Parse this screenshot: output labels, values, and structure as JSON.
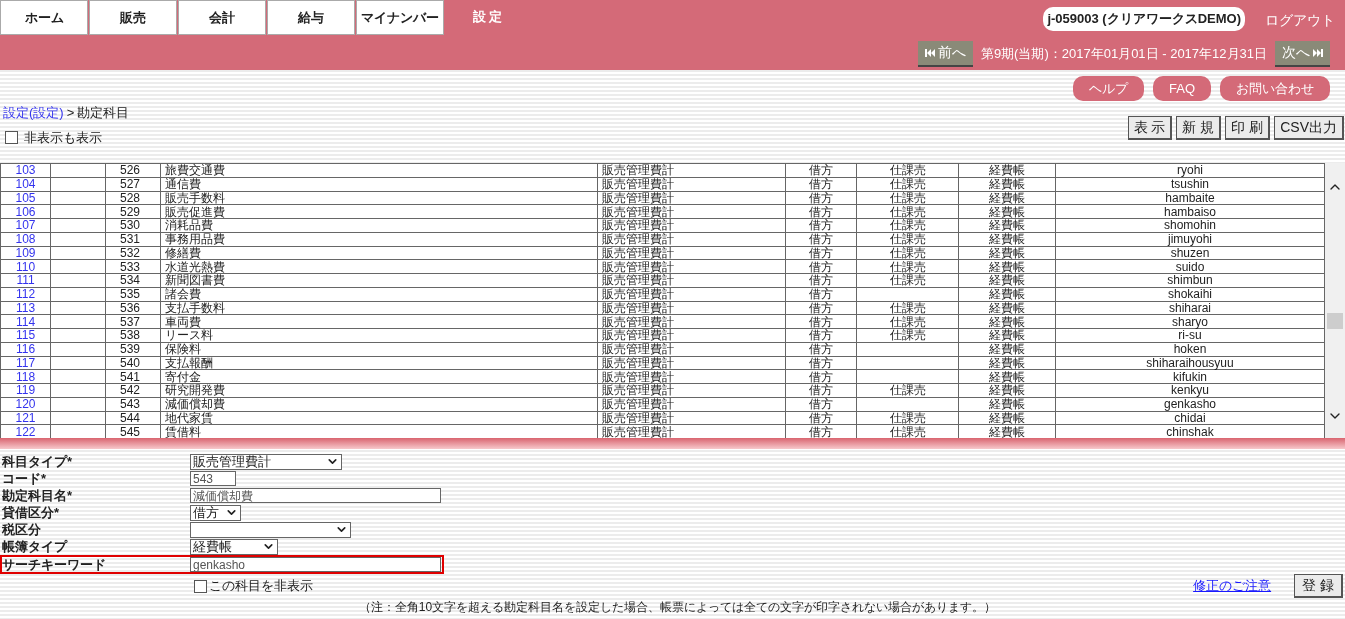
{
  "tabs": [
    {
      "label": "ホーム",
      "selected": false
    },
    {
      "label": "販売",
      "selected": false
    },
    {
      "label": "会計",
      "selected": false
    },
    {
      "label": "給与",
      "selected": false
    },
    {
      "label": "マイナンバー",
      "selected": false
    },
    {
      "label": "設定",
      "selected": true
    }
  ],
  "user": "j-059003 (クリアワークスDEMO)",
  "logout": "ログアウト",
  "period": {
    "prev": "前へ",
    "label": "第9期(当期)：2017年01月01日 - 2017年12月31日",
    "next": "次へ"
  },
  "help_buttons": [
    "ヘルプ",
    "FAQ",
    "お問い合わせ"
  ],
  "breadcrumb": {
    "link": "設定(設定)",
    "separator": ">",
    "current": "勘定科目"
  },
  "show_hidden": {
    "label": "非表示も表示",
    "checked": false
  },
  "toolbar": [
    "表 示",
    "新 規",
    "印 刷",
    "CSV出力"
  ],
  "table": {
    "rows": [
      {
        "no": "103",
        "code": "526",
        "name": "旅費交通費",
        "type": "販売管理費計",
        "side": "借方",
        "tax": "仕課売",
        "ledger": "経費帳",
        "keyword": "ryohi"
      },
      {
        "no": "104",
        "code": "527",
        "name": "通信費",
        "type": "販売管理費計",
        "side": "借方",
        "tax": "仕課売",
        "ledger": "経費帳",
        "keyword": "tsushin"
      },
      {
        "no": "105",
        "code": "528",
        "name": "販売手数料",
        "type": "販売管理費計",
        "side": "借方",
        "tax": "仕課売",
        "ledger": "経費帳",
        "keyword": "hambaite"
      },
      {
        "no": "106",
        "code": "529",
        "name": "販売促進費",
        "type": "販売管理費計",
        "side": "借方",
        "tax": "仕課売",
        "ledger": "経費帳",
        "keyword": "hambaiso"
      },
      {
        "no": "107",
        "code": "530",
        "name": "消耗品費",
        "type": "販売管理費計",
        "side": "借方",
        "tax": "仕課売",
        "ledger": "経費帳",
        "keyword": "shomohin"
      },
      {
        "no": "108",
        "code": "531",
        "name": "事務用品費",
        "type": "販売管理費計",
        "side": "借方",
        "tax": "仕課売",
        "ledger": "経費帳",
        "keyword": "jimuyohi"
      },
      {
        "no": "109",
        "code": "532",
        "name": "修繕費",
        "type": "販売管理費計",
        "side": "借方",
        "tax": "仕課売",
        "ledger": "経費帳",
        "keyword": "shuzen"
      },
      {
        "no": "110",
        "code": "533",
        "name": "水道光熱費",
        "type": "販売管理費計",
        "side": "借方",
        "tax": "仕課売",
        "ledger": "経費帳",
        "keyword": "suido"
      },
      {
        "no": "111",
        "code": "534",
        "name": "新聞図書費",
        "type": "販売管理費計",
        "side": "借方",
        "tax": "仕課売",
        "ledger": "経費帳",
        "keyword": "shimbun"
      },
      {
        "no": "112",
        "code": "535",
        "name": "諸会費",
        "type": "販売管理費計",
        "side": "借方",
        "ledger": "経費帳",
        "keyword": "shokaihi"
      },
      {
        "no": "113",
        "code": "536",
        "name": "支払手数料",
        "type": "販売管理費計",
        "side": "借方",
        "tax": "仕課売",
        "ledger": "経費帳",
        "keyword": "shiharai"
      },
      {
        "no": "114",
        "code": "537",
        "name": "車両費",
        "type": "販売管理費計",
        "side": "借方",
        "tax": "仕課売",
        "ledger": "経費帳",
        "keyword": "sharyo"
      },
      {
        "no": "115",
        "code": "538",
        "name": "リース料",
        "type": "販売管理費計",
        "side": "借方",
        "tax": "仕課売",
        "ledger": "経費帳",
        "keyword": "ri-su"
      },
      {
        "no": "116",
        "code": "539",
        "name": "保険料",
        "type": "販売管理費計",
        "side": "借方",
        "ledger": "経費帳",
        "keyword": "hoken"
      },
      {
        "no": "117",
        "code": "540",
        "name": "支払報酬",
        "type": "販売管理費計",
        "side": "借方",
        "ledger": "経費帳",
        "keyword": "shiharaihousyuu"
      },
      {
        "no": "118",
        "code": "541",
        "name": "寄付金",
        "type": "販売管理費計",
        "side": "借方",
        "ledger": "経費帳",
        "keyword": "kifukin"
      },
      {
        "no": "119",
        "code": "542",
        "name": "研究開発費",
        "type": "販売管理費計",
        "side": "借方",
        "tax": "仕課売",
        "ledger": "経費帳",
        "keyword": "kenkyu"
      },
      {
        "no": "120",
        "code": "543",
        "name": "減価償却費",
        "type": "販売管理費計",
        "side": "借方",
        "ledger": "経費帳",
        "keyword": "genkasho"
      },
      {
        "no": "121",
        "code": "544",
        "name": "地代家賃",
        "type": "販売管理費計",
        "side": "借方",
        "tax": "仕課売",
        "ledger": "経費帳",
        "keyword": "chidai"
      },
      {
        "no": "122",
        "code": "545",
        "name": "賃借料",
        "type": "販売管理費計",
        "side": "借方",
        "tax": "仕課売",
        "ledger": "経費帳",
        "keyword": "chinshak"
      }
    ]
  },
  "form": {
    "fields": [
      {
        "label": "科目タイプ*",
        "kind": "select",
        "value": "販売管理費計",
        "highlighted": false
      },
      {
        "label": "コード*",
        "kind": "text",
        "value": "543",
        "highlighted": false
      },
      {
        "label": "勘定科目名*",
        "kind": "text",
        "value": "減価償却費",
        "highlighted": false
      },
      {
        "label": "貸借区分*",
        "kind": "select",
        "value": "借方",
        "highlighted": false
      },
      {
        "label": "税区分",
        "kind": "select",
        "highlighted": false
      },
      {
        "label": "帳簿タイプ",
        "kind": "select",
        "value": "経費帳",
        "highlighted": false
      },
      {
        "label": "サーチキーワード",
        "kind": "text",
        "value": "genkasho",
        "highlighted": true
      }
    ],
    "hide_item": {
      "label": "この科目を非表示",
      "checked": false
    },
    "caution_link": "修正のご注意",
    "submit": "登 録",
    "note": "（注：全角10文字を超える勘定科目名を設定した場合、帳票によっては全ての文字が印字されない場合があります。）"
  }
}
